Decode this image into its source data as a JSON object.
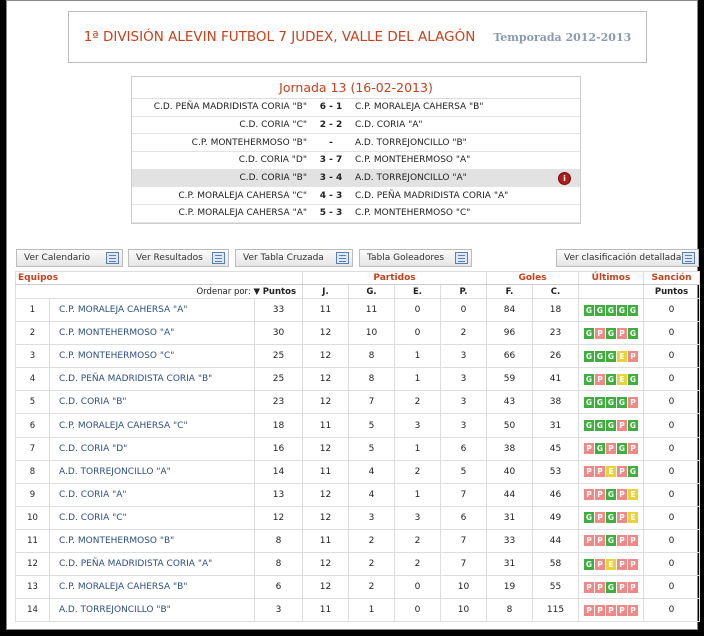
{
  "header": {
    "title": "1ª DIVISIÓN ALEVIN FUTBOL 7 JUDEX, VALLE DEL ALAGÓN",
    "season": "Temporada 2012-2013"
  },
  "round": {
    "title": "Jornada 13 (16-02-2013)",
    "matches": [
      {
        "home": "C.D. PEÑA MADRIDISTA CORIA \"B\"",
        "score": "6 - 1",
        "away": "C.P. MORALEJA CAHERSA \"B\""
      },
      {
        "home": "C.D. CORIA \"C\"",
        "score": "2 - 2",
        "away": "C.D. CORIA \"A\""
      },
      {
        "home": "C.P. MONTEHERMOSO \"B\"",
        "score": "-",
        "away": "A.D. TORREJONCILLO \"B\""
      },
      {
        "home": "C.D. CORIA \"D\"",
        "score": "3 - 7",
        "away": "C.P. MONTEHERMOSO \"A\""
      },
      {
        "home": "C.D. CORIA \"B\"",
        "score": "3 - 4",
        "away": "A.D. TORREJONCILLO \"A\""
      },
      {
        "home": "C.P. MORALEJA CAHERSA \"C\"",
        "score": "4 - 3",
        "away": "C.D. PEÑA MADRIDISTA CORIA \"A\""
      },
      {
        "home": "C.P. MORALEJA CAHERSA \"A\"",
        "score": "5 - 3",
        "away": "C.P. MONTEHERMOSO \"C\""
      }
    ],
    "info_icon_text": "i"
  },
  "buttons": {
    "calendar": "Ver Calendario",
    "results": "Ver Resultados",
    "cross_table": "Ver Tabla Cruzada",
    "scorers": "Tabla Goleadores",
    "detailed": "Ver clasificación detallada"
  },
  "standings": {
    "groups": {
      "teams": "Equipos",
      "matches": "Partidos",
      "goals": "Goles",
      "last": "Últimos",
      "sanction": "Sanción"
    },
    "columns": {
      "order_by": "Ordenar por:",
      "points": "Puntos",
      "played": "J.",
      "won": "G.",
      "drawn": "E.",
      "lost": "P.",
      "gf": "F.",
      "ga": "C.",
      "sanction_points": "Puntos"
    },
    "rows": [
      {
        "pos": "1",
        "team": "C.P. MORALEJA CAHERSA \"A\"",
        "pts": "33",
        "j": "11",
        "g": "11",
        "e": "0",
        "p": "0",
        "f": "84",
        "c": "18",
        "last": [
          "G",
          "G",
          "G",
          "G",
          "G"
        ],
        "sp": "0"
      },
      {
        "pos": "2",
        "team": "C.P. MONTEHERMOSO \"A\"",
        "pts": "30",
        "j": "12",
        "g": "10",
        "e": "0",
        "p": "2",
        "f": "96",
        "c": "23",
        "last": [
          "G",
          "P",
          "G",
          "P",
          "G"
        ],
        "sp": "0"
      },
      {
        "pos": "3",
        "team": "C.P. MONTEHERMOSO \"C\"",
        "pts": "25",
        "j": "12",
        "g": "8",
        "e": "1",
        "p": "3",
        "f": "66",
        "c": "26",
        "last": [
          "G",
          "G",
          "G",
          "E",
          "P"
        ],
        "sp": "0"
      },
      {
        "pos": "4",
        "team": "C.D. PEÑA MADRIDISTA CORIA \"B\"",
        "pts": "25",
        "j": "12",
        "g": "8",
        "e": "1",
        "p": "3",
        "f": "59",
        "c": "41",
        "last": [
          "G",
          "P",
          "G",
          "E",
          "G"
        ],
        "sp": "0"
      },
      {
        "pos": "5",
        "team": "C.D. CORIA \"B\"",
        "pts": "23",
        "j": "12",
        "g": "7",
        "e": "2",
        "p": "3",
        "f": "43",
        "c": "38",
        "last": [
          "G",
          "G",
          "G",
          "G",
          "P"
        ],
        "sp": "0"
      },
      {
        "pos": "6",
        "team": "C.P. MORALEJA CAHERSA \"C\"",
        "pts": "18",
        "j": "11",
        "g": "5",
        "e": "3",
        "p": "3",
        "f": "50",
        "c": "31",
        "last": [
          "G",
          "G",
          "G",
          "P",
          "G"
        ],
        "sp": "0"
      },
      {
        "pos": "7",
        "team": "C.D. CORIA \"D\"",
        "pts": "16",
        "j": "12",
        "g": "5",
        "e": "1",
        "p": "6",
        "f": "38",
        "c": "45",
        "last": [
          "P",
          "G",
          "P",
          "G",
          "P"
        ],
        "sp": "0"
      },
      {
        "pos": "8",
        "team": "A.D. TORREJONCILLO \"A\"",
        "pts": "14",
        "j": "11",
        "g": "4",
        "e": "2",
        "p": "5",
        "f": "40",
        "c": "53",
        "last": [
          "P",
          "P",
          "E",
          "P",
          "G"
        ],
        "sp": "0"
      },
      {
        "pos": "9",
        "team": "C.D. CORIA \"A\"",
        "pts": "13",
        "j": "12",
        "g": "4",
        "e": "1",
        "p": "7",
        "f": "44",
        "c": "46",
        "last": [
          "P",
          "P",
          "G",
          "P",
          "E"
        ],
        "sp": "0"
      },
      {
        "pos": "10",
        "team": "C.D. CORIA \"C\"",
        "pts": "12",
        "j": "12",
        "g": "3",
        "e": "3",
        "p": "6",
        "f": "31",
        "c": "49",
        "last": [
          "G",
          "P",
          "G",
          "P",
          "E"
        ],
        "sp": "0"
      },
      {
        "pos": "11",
        "team": "C.P. MONTEHERMOSO \"B\"",
        "pts": "8",
        "j": "11",
        "g": "2",
        "e": "2",
        "p": "7",
        "f": "33",
        "c": "44",
        "last": [
          "P",
          "P",
          "G",
          "P",
          "P"
        ],
        "sp": "0"
      },
      {
        "pos": "12",
        "team": "C.D. PEÑA MADRIDISTA CORIA \"A\"",
        "pts": "8",
        "j": "12",
        "g": "2",
        "e": "2",
        "p": "7",
        "f": "31",
        "c": "58",
        "last": [
          "G",
          "P",
          "E",
          "P",
          "P"
        ],
        "sp": "0"
      },
      {
        "pos": "13",
        "team": "C.P. MORALEJA CAHERSA \"B\"",
        "pts": "6",
        "j": "12",
        "g": "2",
        "e": "0",
        "p": "10",
        "f": "19",
        "c": "55",
        "last": [
          "P",
          "P",
          "G",
          "P",
          "P"
        ],
        "sp": "0"
      },
      {
        "pos": "14",
        "team": "A.D. TORREJONCILLO \"B\"",
        "pts": "3",
        "j": "11",
        "g": "1",
        "e": "0",
        "p": "10",
        "f": "8",
        "c": "115",
        "last": [
          "P",
          "P",
          "P",
          "P",
          "P"
        ],
        "sp": "0"
      }
    ]
  },
  "colors": {
    "accent": "#c8401a",
    "team_link": "#2c4f82",
    "win": "#3fae3f",
    "loss": "#f08888",
    "draw": "#e6d43a"
  }
}
